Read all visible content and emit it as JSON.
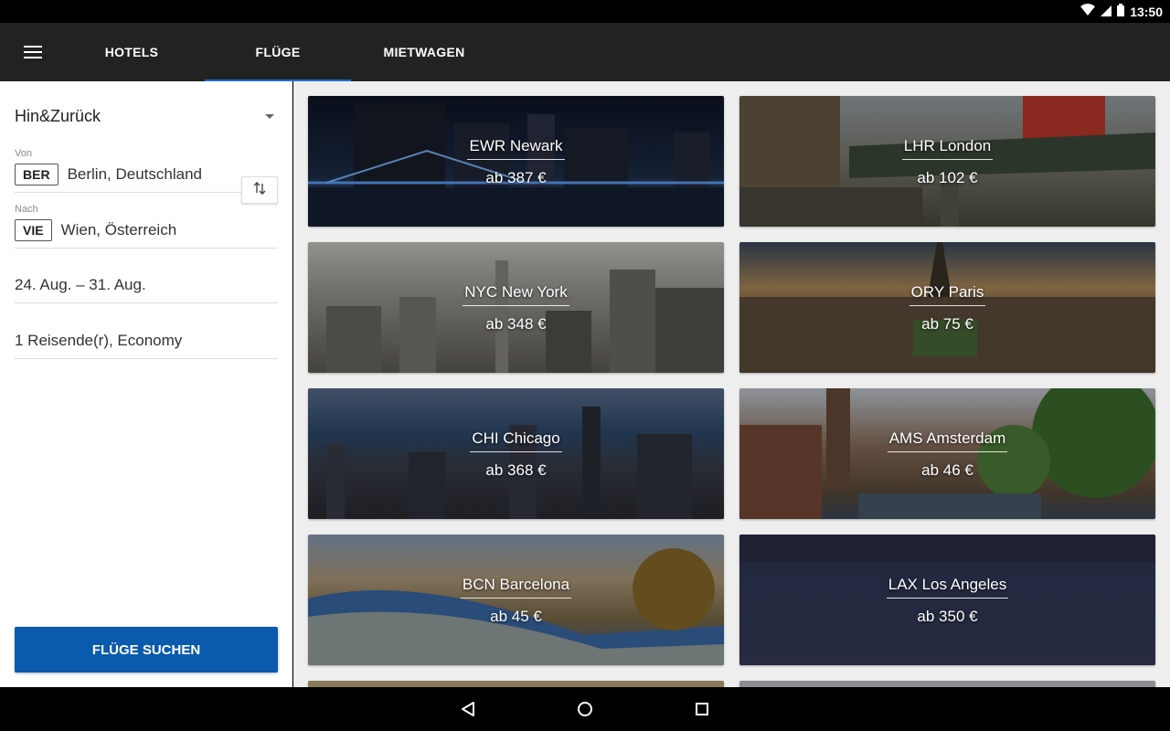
{
  "status_bar": {
    "time": "13:50"
  },
  "tabs": [
    {
      "label": "HOTELS",
      "active": false
    },
    {
      "label": "FLÜGE",
      "active": true
    },
    {
      "label": "MIETWAGEN",
      "active": false
    }
  ],
  "accent_color": "#1e6fd9",
  "form": {
    "trip_type": "Hin&Zurück",
    "from_label": "Von",
    "from_code": "BER",
    "from_name": "Berlin, Deutschland",
    "to_label": "Nach",
    "to_code": "VIE",
    "to_name": "Wien, Österreich",
    "dates": "24. Aug. – 31. Aug.",
    "travelers": "1 Reisende(r), Economy",
    "search_label": "FLÜGE SUCHEN",
    "search_color": "#0a5aad"
  },
  "destinations": [
    {
      "title": "EWR Newark",
      "price": "ab 387 €"
    },
    {
      "title": "LHR London",
      "price": "ab 102 €"
    },
    {
      "title": "NYC New York",
      "price": "ab 348 €"
    },
    {
      "title": "ORY Paris",
      "price": "ab 75 €"
    },
    {
      "title": "CHI Chicago",
      "price": "ab 368 €"
    },
    {
      "title": "AMS Amsterdam",
      "price": "ab 46 €"
    },
    {
      "title": "BCN Barcelona",
      "price": "ab 45 €"
    },
    {
      "title": "LAX Los Angeles",
      "price": "ab 350 €"
    }
  ],
  "icons": {
    "menu": "hamburger-menu-icon",
    "swap": "swap-vertical-icon",
    "dropdown": "chevron-down-icon",
    "back": "back-triangle-icon",
    "home": "home-circle-icon",
    "recents": "recents-square-icon"
  }
}
